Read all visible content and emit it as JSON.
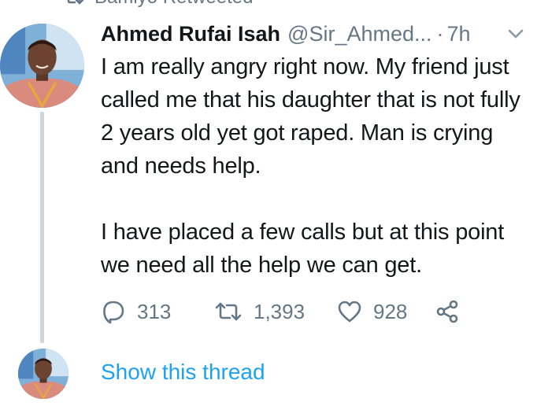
{
  "retweet_context": {
    "icon": "retweet-icon",
    "text": "Bamiyo Retweeted"
  },
  "tweet": {
    "author": {
      "display_name": "Ahmed Rufai Isah",
      "handle": "@Sir_Ahmed...",
      "avatar": "avatar"
    },
    "separator": "·",
    "time": "7h",
    "menu_icon": "chevron-down-icon",
    "paragraphs": [
      "I am really angry right now. My friend just called me that his daughter that is not fully 2 years old yet got raped. Man is crying and needs help.",
      "I have placed a few calls but at this point we need all the help we can get."
    ],
    "actions": {
      "reply": {
        "icon": "reply-icon",
        "count": "313"
      },
      "retweet": {
        "icon": "retweet-icon",
        "count": "1,393"
      },
      "like": {
        "icon": "heart-icon",
        "count": "928"
      },
      "share": {
        "icon": "share-icon"
      }
    }
  },
  "thread": {
    "link_label": "Show this thread"
  },
  "colors": {
    "text": "#14171a",
    "secondary": "#657786",
    "link": "#1da1f2",
    "thread_line": "#ccd6dd"
  }
}
